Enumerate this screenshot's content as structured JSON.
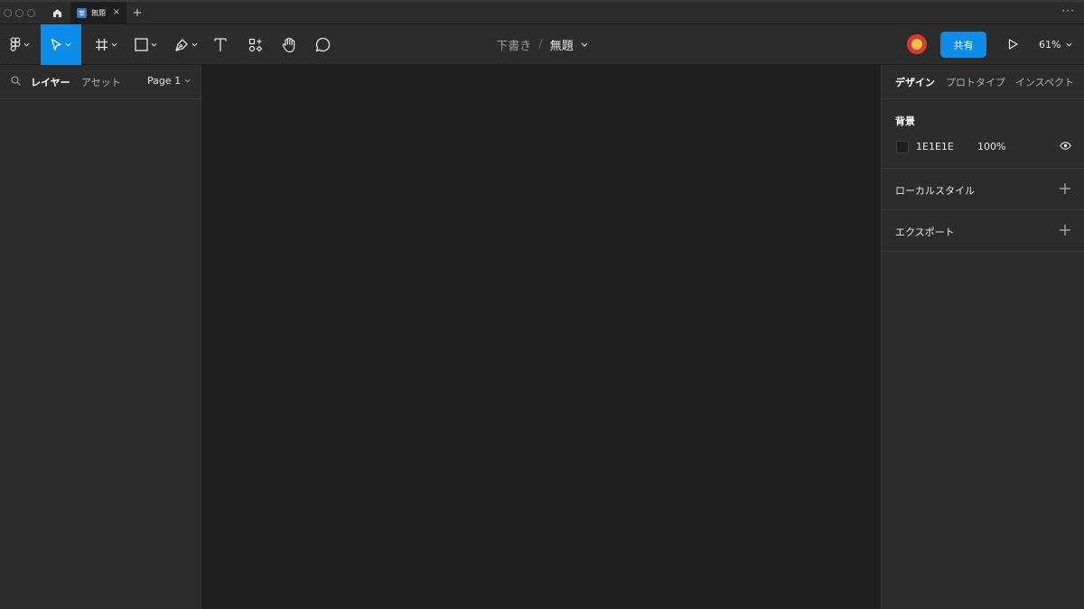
{
  "tabbar": {
    "file_tab_title": "無題",
    "close_glyph": "×",
    "new_tab_glyph": "+",
    "more_glyph": "···"
  },
  "toolbar": {
    "tools": [
      "main-menu",
      "move",
      "frame",
      "shape",
      "pen",
      "text",
      "resources",
      "hand",
      "comment"
    ],
    "active_tool": "move",
    "breadcrumb": {
      "drafts": "下書き",
      "separator": "/",
      "file": "無題"
    },
    "share_label": "共有",
    "zoom_label": "61%"
  },
  "left_panel": {
    "tabs": {
      "layers": "レイヤー",
      "assets": "アセット"
    },
    "active_tab": "layers",
    "page_selector": "Page 1"
  },
  "right_panel": {
    "tabs": {
      "design": "デザイン",
      "prototype": "プロトタイプ",
      "inspect": "インスペクト"
    },
    "active_tab": "design",
    "background": {
      "heading": "背景",
      "hex": "1E1E1E",
      "opacity": "100%"
    },
    "local_styles_label": "ローカルスタイル",
    "export_label": "エクスポート"
  },
  "colors": {
    "accent": "#0d8ce9",
    "panel": "#2c2c2c",
    "canvas": "#1e1e1e"
  }
}
